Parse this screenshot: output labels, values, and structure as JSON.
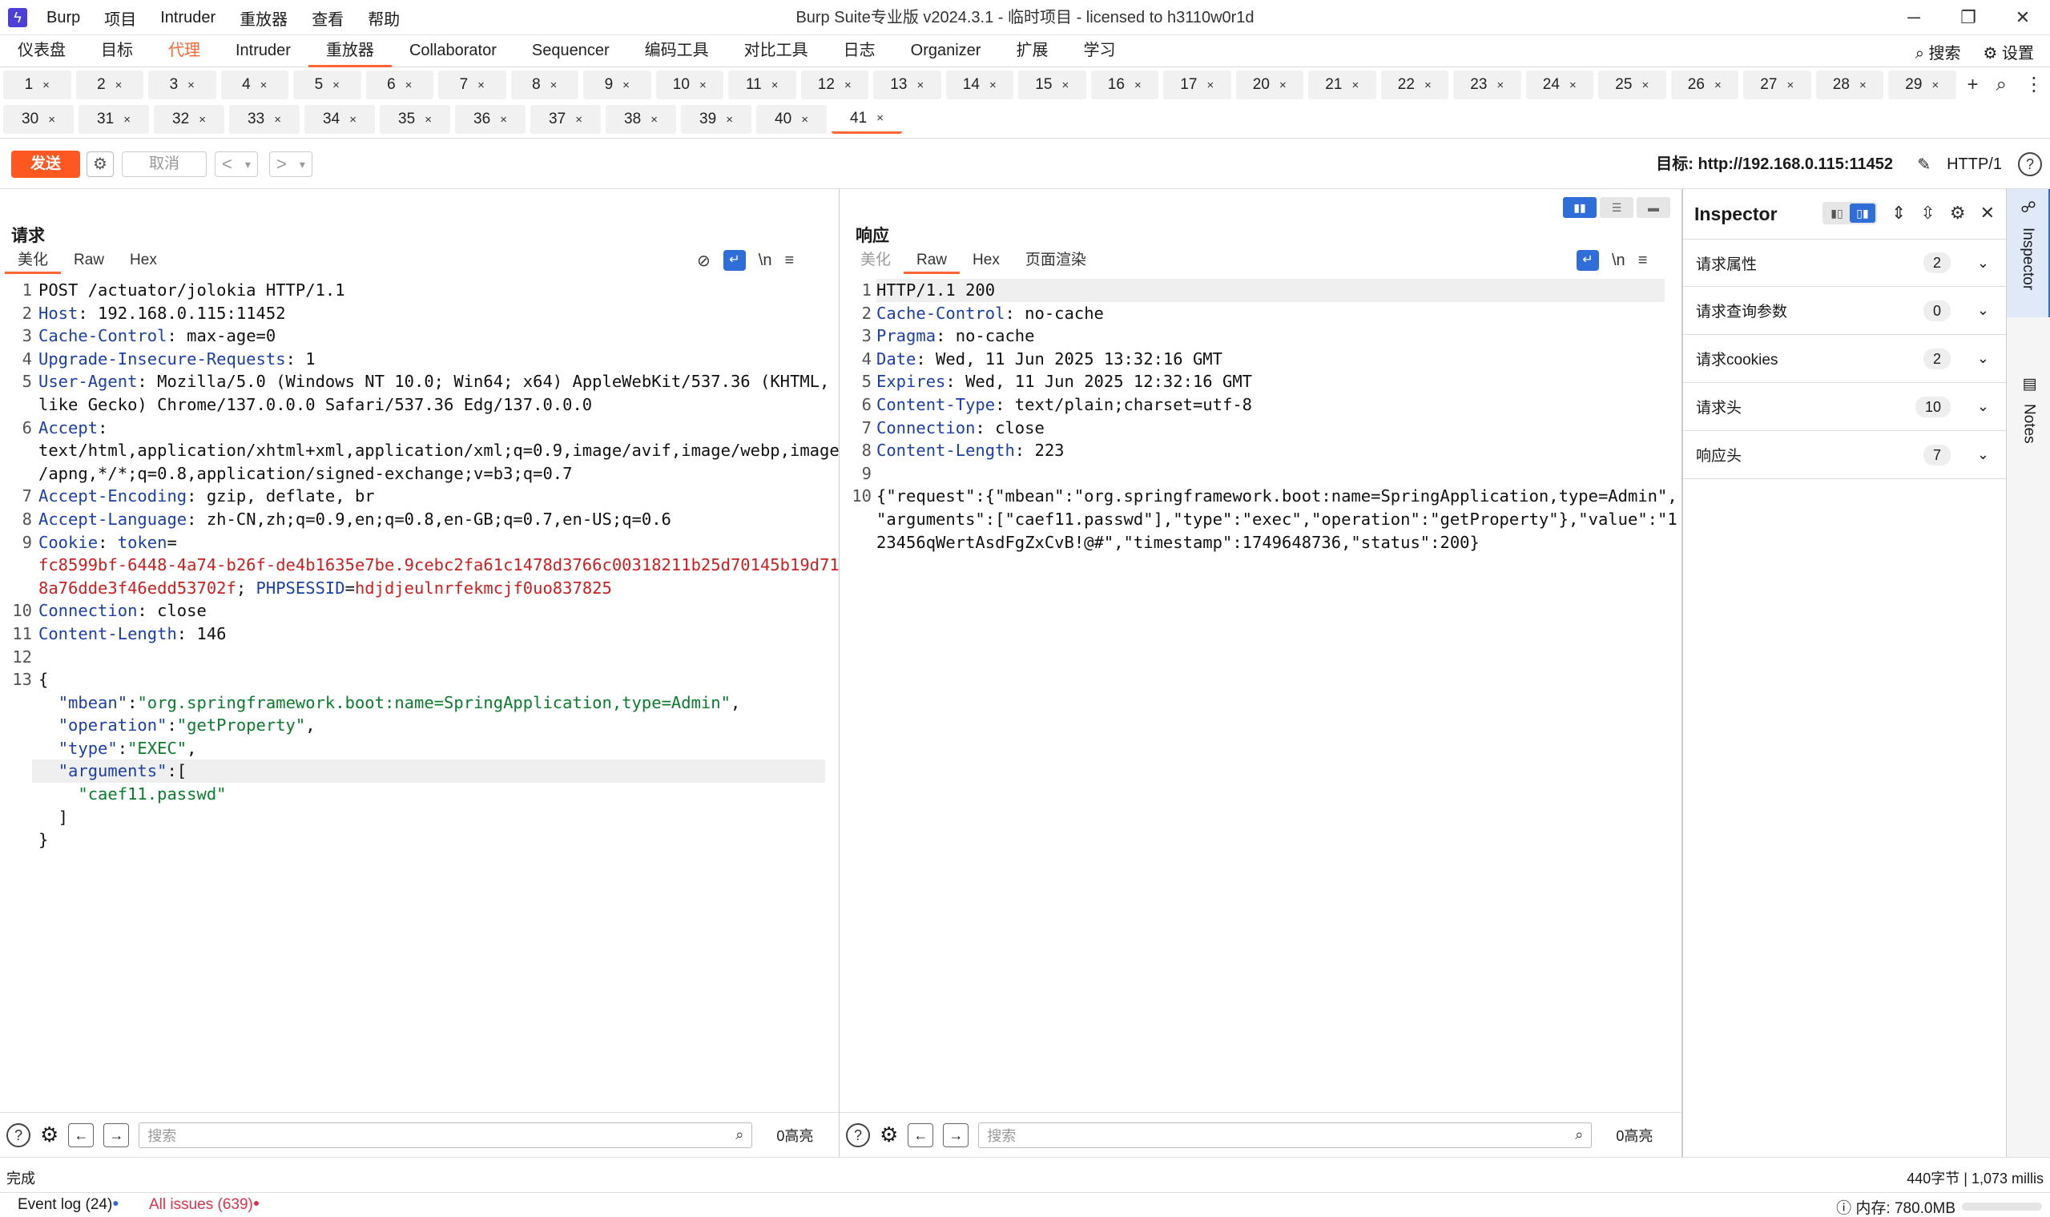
{
  "titlebar": {
    "logo_icon": "lightning-icon",
    "menus": [
      "Burp",
      "项目",
      "Intruder",
      "重放器",
      "查看",
      "帮助"
    ],
    "title": "Burp Suite专业版  v2024.3.1 - 临时项目 - licensed to h3110w0r1d",
    "controls": [
      "─",
      "❐",
      "✕"
    ]
  },
  "maintabs": {
    "items": [
      "仪表盘",
      "目标",
      "代理",
      "Intruder",
      "重放器",
      "Collaborator",
      "Sequencer",
      "编码工具",
      "对比工具",
      "日志",
      "Organizer",
      "扩展",
      "学习"
    ],
    "search_label": "搜索",
    "settings_label": "设置"
  },
  "tabs_row1": [
    "1",
    "2",
    "3",
    "4",
    "5",
    "6",
    "7",
    "8",
    "9",
    "10",
    "11",
    "12",
    "13",
    "14",
    "15",
    "16",
    "17",
    "20",
    "21",
    "22",
    "23",
    "24",
    "25",
    "26",
    "27",
    "28",
    "29"
  ],
  "tabs_row2": [
    "30",
    "31",
    "32",
    "33",
    "34",
    "35",
    "36",
    "37",
    "38",
    "39",
    "40",
    "41"
  ],
  "tab_close": "×",
  "tab_add": "+",
  "tab_search": "⌕",
  "tab_more": "⋮",
  "toolbar": {
    "send": "发送",
    "cancel": "取消",
    "prev": "<",
    "next": ">",
    "dropdown": "▾",
    "target": "目标: http://192.168.0.115:11452",
    "protocol": "HTTP/1",
    "help": "?"
  },
  "request": {
    "title": "请求",
    "tabs": [
      "美化",
      "Raw",
      "Hex"
    ],
    "search_placeholder": "搜索",
    "hits": "0高亮"
  },
  "response": {
    "title": "响应",
    "tabs": [
      "美化",
      "Raw",
      "Hex",
      "页面渲染"
    ],
    "search_placeholder": "搜索",
    "hits": "0高亮"
  },
  "inspector": {
    "title": "Inspector",
    "rows": [
      {
        "label": "请求属性",
        "count": "2"
      },
      {
        "label": "请求查询参数",
        "count": "0"
      },
      {
        "label": "请求cookies",
        "count": "2"
      },
      {
        "label": "请求头",
        "count": "10"
      },
      {
        "label": "响应头",
        "count": "7"
      }
    ],
    "rail": [
      "Inspector",
      "Notes"
    ]
  },
  "status": {
    "left": "完成",
    "right": "440字节 | 1,073 millis"
  },
  "footer": {
    "event_log": "Event log (24)",
    "all_issues": "All issues (639)",
    "memory": "内存: 780.0MB"
  }
}
